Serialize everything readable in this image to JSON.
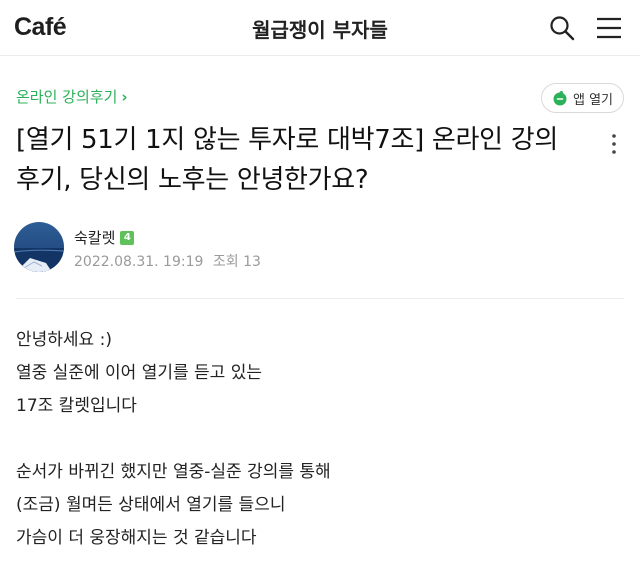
{
  "header": {
    "logo": "Café",
    "cafe_name": "월급쟁이 부자들"
  },
  "board": {
    "name": "온라인 강의후기",
    "chevron": "›"
  },
  "app_button": {
    "label": "앱 열기"
  },
  "post": {
    "title": "[열기 51기 1지 않는 투자로 대박7조] 온라인 강의 후기, 당신의 노후는 안녕한가요?",
    "author": "숙칼렛",
    "level": "4",
    "date": "2022.08.31. 19:19",
    "views_label": "조회 13"
  },
  "content": {
    "lines": [
      "안녕하세요 :)",
      "열중 실준에 이어 열기를 듣고 있는",
      "17조 칼렛입니다",
      "",
      "순서가 바뀌긴 했지만 열중-실준 강의를 통해",
      "(조금) 월며든 상태에서 열기를 들으니",
      "가슴이 더 웅장해지는 것 같습니다"
    ]
  },
  "colors": {
    "accent_green": "#2bb15a",
    "badge_green": "#5fc15a"
  },
  "icons": [
    "search-icon",
    "menu-icon",
    "chevron-right-icon",
    "cafe-cup-icon",
    "more-vertical-icon",
    "level-badge-icon"
  ]
}
